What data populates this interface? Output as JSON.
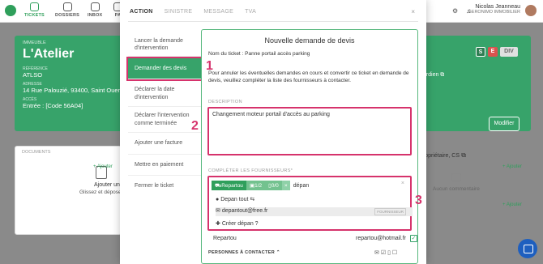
{
  "topbar": {
    "nav": [
      {
        "label": "TICKETS",
        "active": true
      },
      {
        "label": "DOSSIERS",
        "active": false
      },
      {
        "label": "INBOX",
        "active": false
      },
      {
        "label": "PA",
        "active": false
      }
    ],
    "user_name": "Nicolas Jeanneau",
    "user_company": "GERONIMO IMMOBILIER"
  },
  "building": {
    "kicker": "IMMEUBLE",
    "title": "L'Atelier",
    "ref_label": "RÉFÉRENCE",
    "ref_value": "ATLSO",
    "addr_label": "ADRESSE",
    "addr_value": "14 Rue Palouzié, 93400, Saint Ouen",
    "access_label": "ACCÈS",
    "access_value": "Entrée : [Code 56A04]",
    "badges": [
      "S",
      "E",
      "DIV"
    ],
    "gardien": "gardien",
    "modify_label": "Modifier"
  },
  "documents": {
    "header": "DOCUMENTS",
    "add_title": "Ajouter un document",
    "add_hint": "Glissez et déposer un documen",
    "add_link": "+ Ajouter"
  },
  "owner": {
    "label": "propriétaire, CS",
    "add_link": "+ Ajouter",
    "comment_empty": "Aucun commentaire",
    "add_link2": "+ Ajouter"
  },
  "modal": {
    "tabs": [
      "ACTION",
      "SINISTRE",
      "MESSAGE",
      "TVA"
    ],
    "active_tab": 0,
    "close": "×",
    "menu": [
      "Lancer la demande d'intervention",
      "Demander des devis",
      "Déclarer la date d'intervention",
      "Déclarer l'intervention comme terminée",
      "Ajouter une facture",
      "Mettre en paiement",
      "Fermer le ticket"
    ],
    "active_menu": 1,
    "panel": {
      "title": "Nouvelle demande de devis",
      "ticket_line": "Nom du ticket : Panne portail accès parking",
      "info_line1": "Pour annuler les éventuelles demandes en cours et convertir ce ticket en demande de",
      "info_line2": "devis, veuillez compléter la liste des fournisseurs à contacter.",
      "desc_label": "DESCRIPTION",
      "desc_value": "Changement moteur portail d'accès au parking",
      "supp_label": "COMPLÉTER LES FOURNISSEURS*",
      "chip_name": "Repartou",
      "chip_count1": "1/2",
      "chip_count2": "0/0",
      "chip_remove": "×",
      "search_value": "dépan",
      "clear": "×",
      "options": [
        {
          "label": "Depan tout"
        },
        {
          "label": "depantout@free.fr",
          "tag": "FOURNISSEUR"
        },
        {
          "label": "Créer dépan ?"
        }
      ],
      "selected_name": "Repartou",
      "selected_email": "repartou@hotmail.fr",
      "contacts_label": "PERSONNES À CONTACTER"
    }
  },
  "markers": [
    "1",
    "2",
    "3"
  ]
}
